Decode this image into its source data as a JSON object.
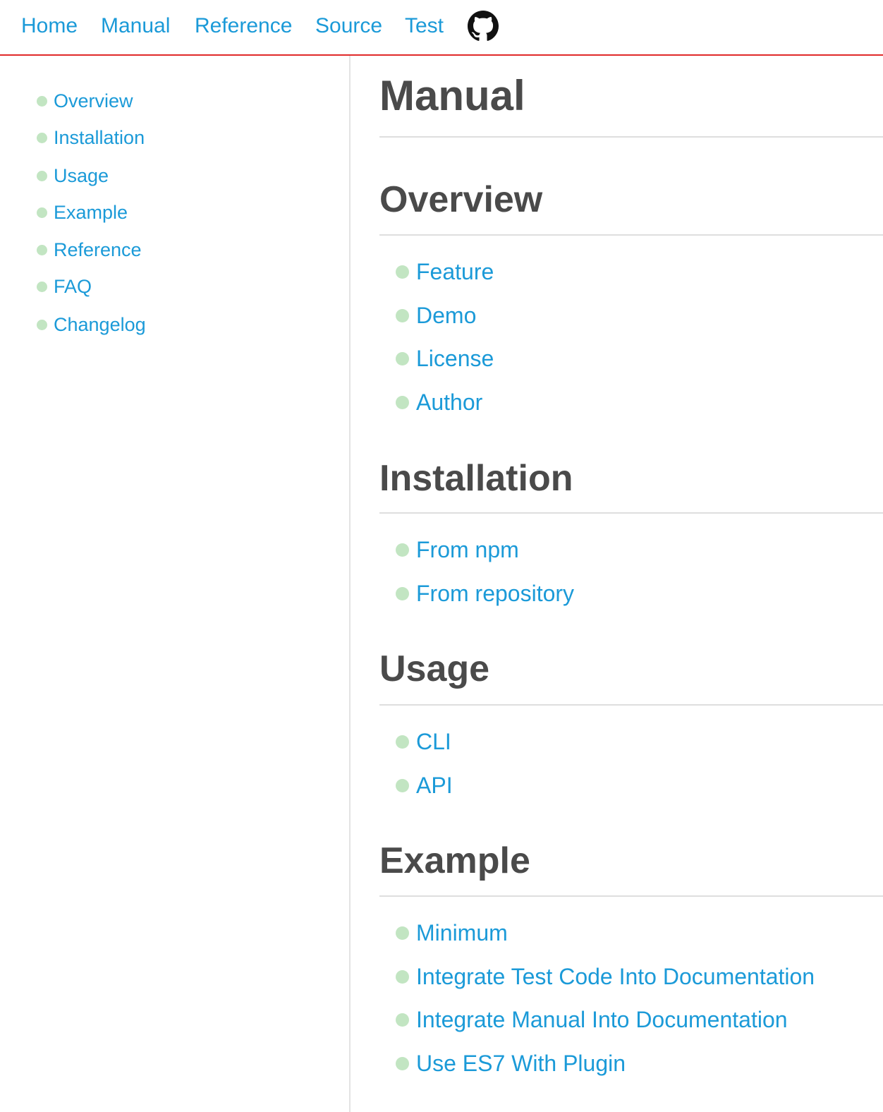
{
  "topnav": {
    "links": [
      "Home",
      "Manual",
      "Reference",
      "Source",
      "Test"
    ],
    "github_icon": "github-icon"
  },
  "sidebar": {
    "items": [
      "Overview",
      "Installation",
      "Usage",
      "Example",
      "Reference",
      "FAQ",
      "Changelog"
    ]
  },
  "main": {
    "title": "Manual",
    "sections": [
      {
        "heading": "Overview",
        "items": [
          "Feature",
          "Demo",
          "License",
          "Author"
        ]
      },
      {
        "heading": "Installation",
        "items": [
          "From npm",
          "From repository"
        ]
      },
      {
        "heading": "Usage",
        "items": [
          "CLI",
          "API"
        ]
      },
      {
        "heading": "Example",
        "items": [
          "Minimum",
          "Integrate Test Code Into Documentation",
          "Integrate Manual Into Documentation",
          "Use ES7 With Plugin"
        ]
      }
    ]
  },
  "colors": {
    "link": "#1b9ad8",
    "heading": "#4a4a4a",
    "bullet": "#c2e5c2",
    "nav_border": "#e02a2a"
  }
}
